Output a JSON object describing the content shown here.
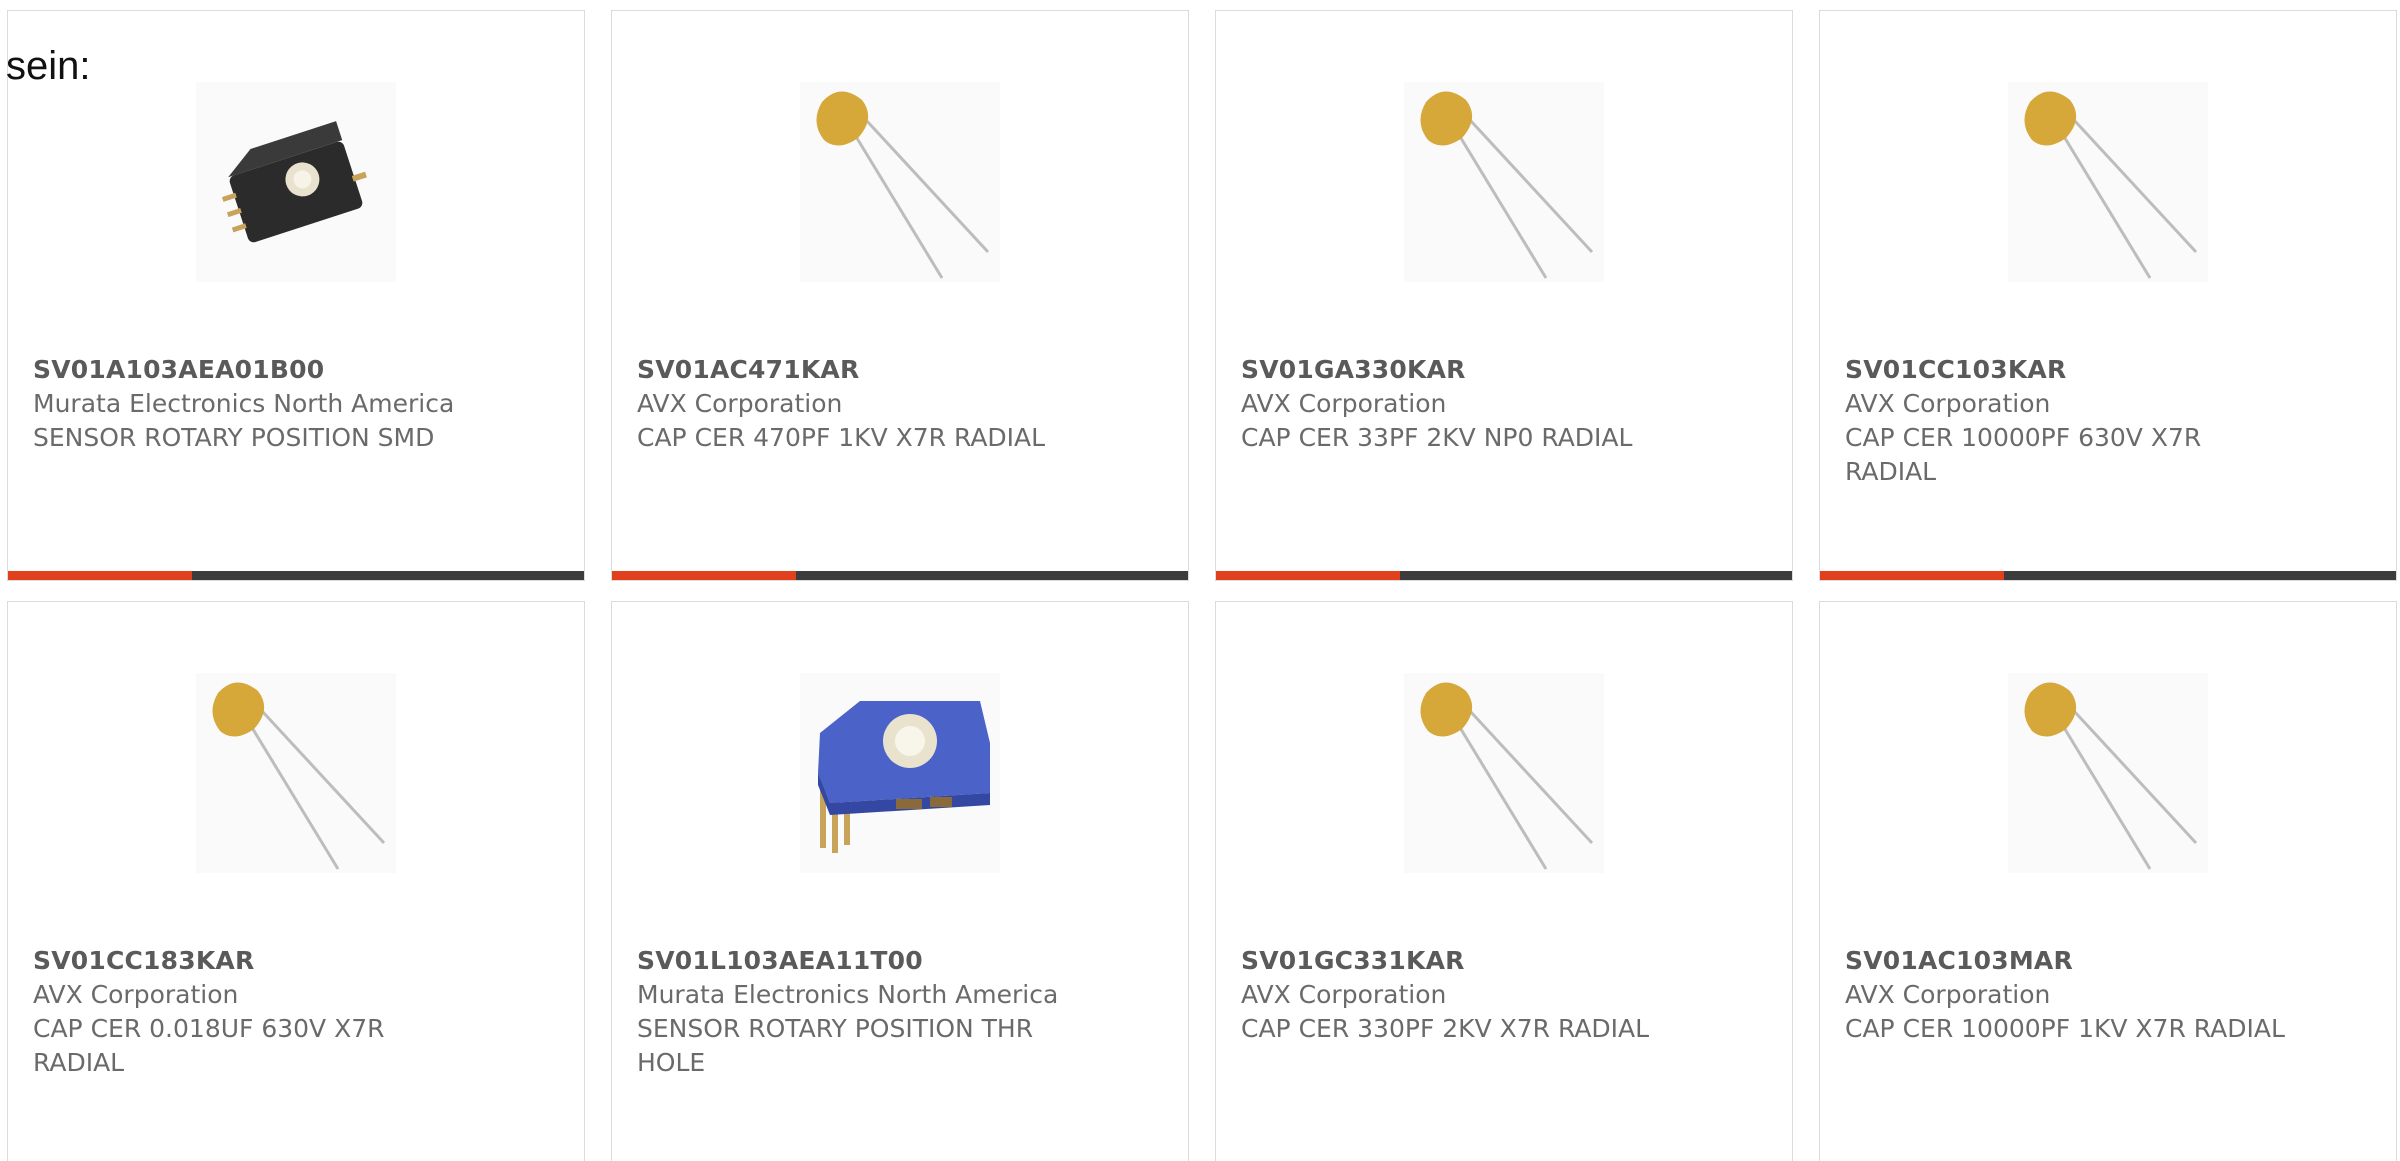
{
  "intro_text": "sein:",
  "colors": {
    "accent": "#e0401c",
    "bar_track": "#3c3c3c",
    "border": "#dcdcdc",
    "text": "#6a6a6a"
  },
  "products": [
    {
      "part": "SV01A103AEA01B00",
      "manufacturer": "Murata Electronics North America",
      "description": "SENSOR ROTARY POSITION SMD",
      "image": "rotary-sensor-smd-icon",
      "progress": 0.32
    },
    {
      "part": "SV01AC471KAR",
      "manufacturer": "AVX Corporation",
      "description": "CAP CER 470PF 1KV X7R RADIAL",
      "image": "ceramic-capacitor-icon",
      "progress": 0.32
    },
    {
      "part": "SV01GA330KAR",
      "manufacturer": "AVX Corporation",
      "description": "CAP CER 33PF 2KV NP0 RADIAL",
      "image": "ceramic-capacitor-icon",
      "progress": 0.32
    },
    {
      "part": "SV01CC103KAR",
      "manufacturer": "AVX Corporation",
      "description": "CAP CER 10000PF 630V X7R RADIAL",
      "image": "ceramic-capacitor-icon",
      "progress": 0.32
    },
    {
      "part": "SV01CC183KAR",
      "manufacturer": "AVX Corporation",
      "description": "CAP CER 0.018UF 630V X7R RADIAL",
      "image": "ceramic-capacitor-icon"
    },
    {
      "part": "SV01L103AEA11T00",
      "manufacturer": "Murata Electronics North America",
      "description": "SENSOR ROTARY POSITION THR HOLE",
      "image": "rotary-sensor-thru-hole-icon"
    },
    {
      "part": "SV01GC331KAR",
      "manufacturer": "AVX Corporation",
      "description": "CAP CER 330PF 2KV X7R RADIAL",
      "image": "ceramic-capacitor-icon"
    },
    {
      "part": "SV01AC103MAR",
      "manufacturer": "AVX Corporation",
      "description": "CAP CER 10000PF 1KV X7R RADIAL",
      "image": "ceramic-capacitor-icon"
    }
  ]
}
